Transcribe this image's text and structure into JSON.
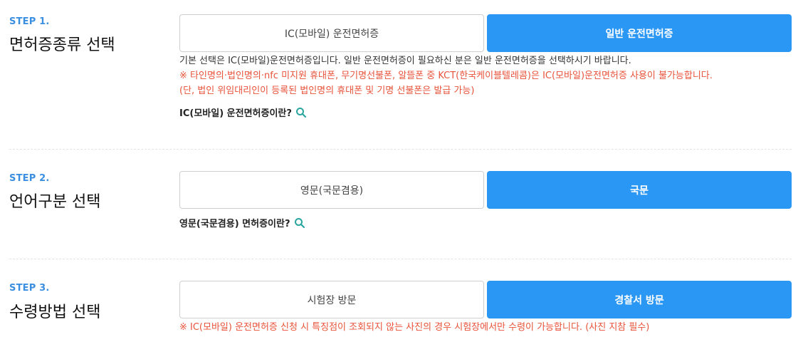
{
  "step1": {
    "no": "STEP 1.",
    "title": "면허증종류 선택",
    "option_ic": "IC(모바일) 운전면허증",
    "option_normal": "일반 운전면허증",
    "note1": "기본 선택은 IC(모바일)운전면허증입니다. 일반 운전면허증이 필요하신 분은 일반 운전면허증을 선택하시기 바랍니다.",
    "note2": "※ 타인명의·법인명의·nfc 미지원 휴대폰, 무기명선불폰, 알뜰폰 중 KCT(한국케이블텔레콤)은 IC(모바일)운전면허증 사용이 불가능합니다.",
    "note3": "(단, 법인 위임대리인이 등록된 법인명의 휴대폰 및 기명 선불폰은 발급 가능)",
    "help": "IC(모바일) 운전면허증이란?"
  },
  "step2": {
    "no": "STEP 2.",
    "title": "언어구분 선택",
    "option_en": "영문(국문겸용)",
    "option_ko": "국문",
    "help": "영문(국문겸용) 면허증이란?"
  },
  "step3": {
    "no": "STEP 3.",
    "title": "수령방법 선택",
    "option_center": "시험장 방문",
    "option_police": "경찰서 방문",
    "note": "※ IC(모바일) 운전면허증 신청 시 특징점이 조회되지 않는 사진의 경우 시험장에서만 수령이 가능합니다. (사진 지참 필수)"
  },
  "colors": {
    "accent": "#2b97f5",
    "step_label": "#3b8fe0",
    "warning": "#e8533a",
    "search_icon": "#2aa6a0"
  },
  "icons": {
    "help_icon": "search-icon"
  }
}
